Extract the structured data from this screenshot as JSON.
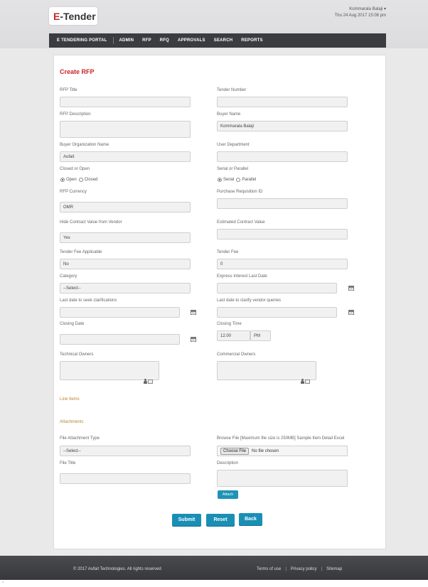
{
  "header": {
    "logo_prefix": "E",
    "logo_suffix": "-Tender",
    "user_name": "Kommarala Balaji ▾",
    "datetime": "Thu 24 Aug 2017 15:08 pm"
  },
  "nav": [
    "E TENDERING PORTAL",
    "ADMIN",
    "RFP",
    "RFQ",
    "APPROVALS",
    "SEARCH",
    "REPORTS"
  ],
  "form": {
    "title": "Create RFP",
    "rfp_title_label": "RFP Title",
    "tender_number_label": "Tender Number",
    "rfp_description_label": "RFP Description",
    "buyer_name_label": "Buyer Name",
    "buyer_name_value": "Kommarala Balaji",
    "buyer_org_label": "Buyer Organization Name",
    "buyer_org_value": "Aufait",
    "user_department_label": "User Department",
    "closed_or_open_label": "Closed or Open",
    "open_label": "Open",
    "closed_label": "Closed",
    "serial_parallel_label": "Serial or Parallel",
    "serial_label": "Serial",
    "parallel_label": "Parallel",
    "rfp_currency_label": "RFP Currency",
    "rfp_currency_value": "OMR",
    "purchase_req_label": "Purchase Requisition ID",
    "hide_contract_label": "Hide Contract Value from Vendor",
    "hide_contract_value": "Yes",
    "estimated_contract_label": "Estimated Contract Value",
    "tender_fee_applicable_label": "Tender Fee Applicable",
    "tender_fee_applicable_value": "No",
    "tender_fee_label": "Tender Fee",
    "tender_fee_value": "0",
    "category_label": "Category",
    "category_value": "--Select--",
    "express_interest_label": "Express Interest Last Date",
    "last_date_clarifications_label": "Last date to seek clarifications",
    "last_date_vendor_label": "Last date to clarify vendor queries",
    "closing_date_label": "Closing Date",
    "closing_time_label": "Closing Time",
    "closing_time_value": "12.00",
    "closing_ampm_value": "PM",
    "technical_owners_label": "Technical Owners",
    "commercial_owners_label": "Commercial Owners",
    "line_items_label": "Line Items",
    "attachments_label": "Attachments",
    "file_attachment_type_label": "File Attachment Type",
    "file_attachment_type_value": "--Select--",
    "browse_file_label": "Browse File [Maximum file size is 250MB] Sample Item Detail Excel",
    "choose_file_label": "Choose File",
    "no_file_label": "No file chosen",
    "file_title_label": "File Title",
    "description_label": "Description",
    "attach_label": "Attach",
    "submit_label": "Submit",
    "reset_label": "Reset",
    "back_label": "Back"
  },
  "footer": {
    "copyright": "© 2017 Aufait Technologies. All rights reserved",
    "terms": "Terms of use",
    "privacy": "Privacy policy",
    "sitemap": "Sitemap",
    "sep": "|"
  },
  "scroll_glyph": "‹"
}
